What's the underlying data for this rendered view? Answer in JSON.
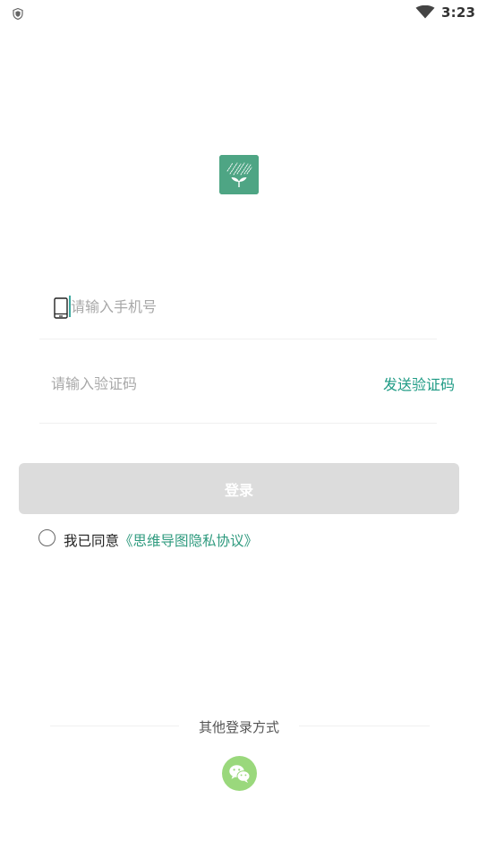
{
  "status_bar": {
    "time": "3:23"
  },
  "login_form": {
    "phone_placeholder": "请输入手机号",
    "code_placeholder": "请输入验证码",
    "send_code_label": "发送验证码",
    "login_label": "登录"
  },
  "agreement": {
    "prefix": "我已同意",
    "policy_link": "《思维导图隐私协议》",
    "checked": false
  },
  "other_login": {
    "label": "其他登录方式",
    "methods": [
      "wechat-icon"
    ]
  },
  "colors": {
    "brand_green": "#4ea584",
    "link_teal": "#1f9b85",
    "login_disabled": "#dcdcdc",
    "wechat_green": "#9ad87c"
  },
  "icons": [
    "shield-icon",
    "wifi-icon",
    "app-logo-icon",
    "phone-icon",
    "wechat-icon"
  ]
}
